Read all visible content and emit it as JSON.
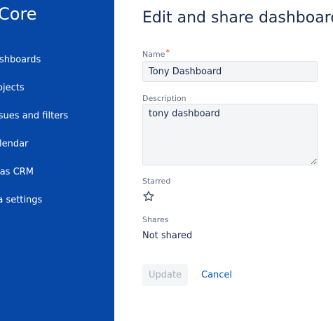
{
  "sidebar": {
    "title": "Core",
    "items": [
      {
        "label": "ashboards"
      },
      {
        "label": "rojects"
      },
      {
        "label": "ssues and filters"
      },
      {
        "label": "alendar"
      },
      {
        "label": "tlas CRM"
      },
      {
        "label": "ra settings"
      }
    ]
  },
  "main": {
    "title": "Edit and share dashboard",
    "name_field": {
      "label": "Name",
      "required_mark": "*",
      "value": "Tony Dashboard"
    },
    "description_field": {
      "label": "Description",
      "value": "tony dashboard"
    },
    "starred": {
      "label": "Starred",
      "icon": "star-outline-icon"
    },
    "shares": {
      "label": "Shares",
      "value": "Not shared"
    },
    "buttons": {
      "update": "Update",
      "cancel": "Cancel"
    }
  },
  "colors": {
    "sidebar_bg": "#0747a6",
    "link": "#0052cc",
    "required": "#de350b",
    "text": "#172b4d",
    "label": "#5e6c84"
  }
}
